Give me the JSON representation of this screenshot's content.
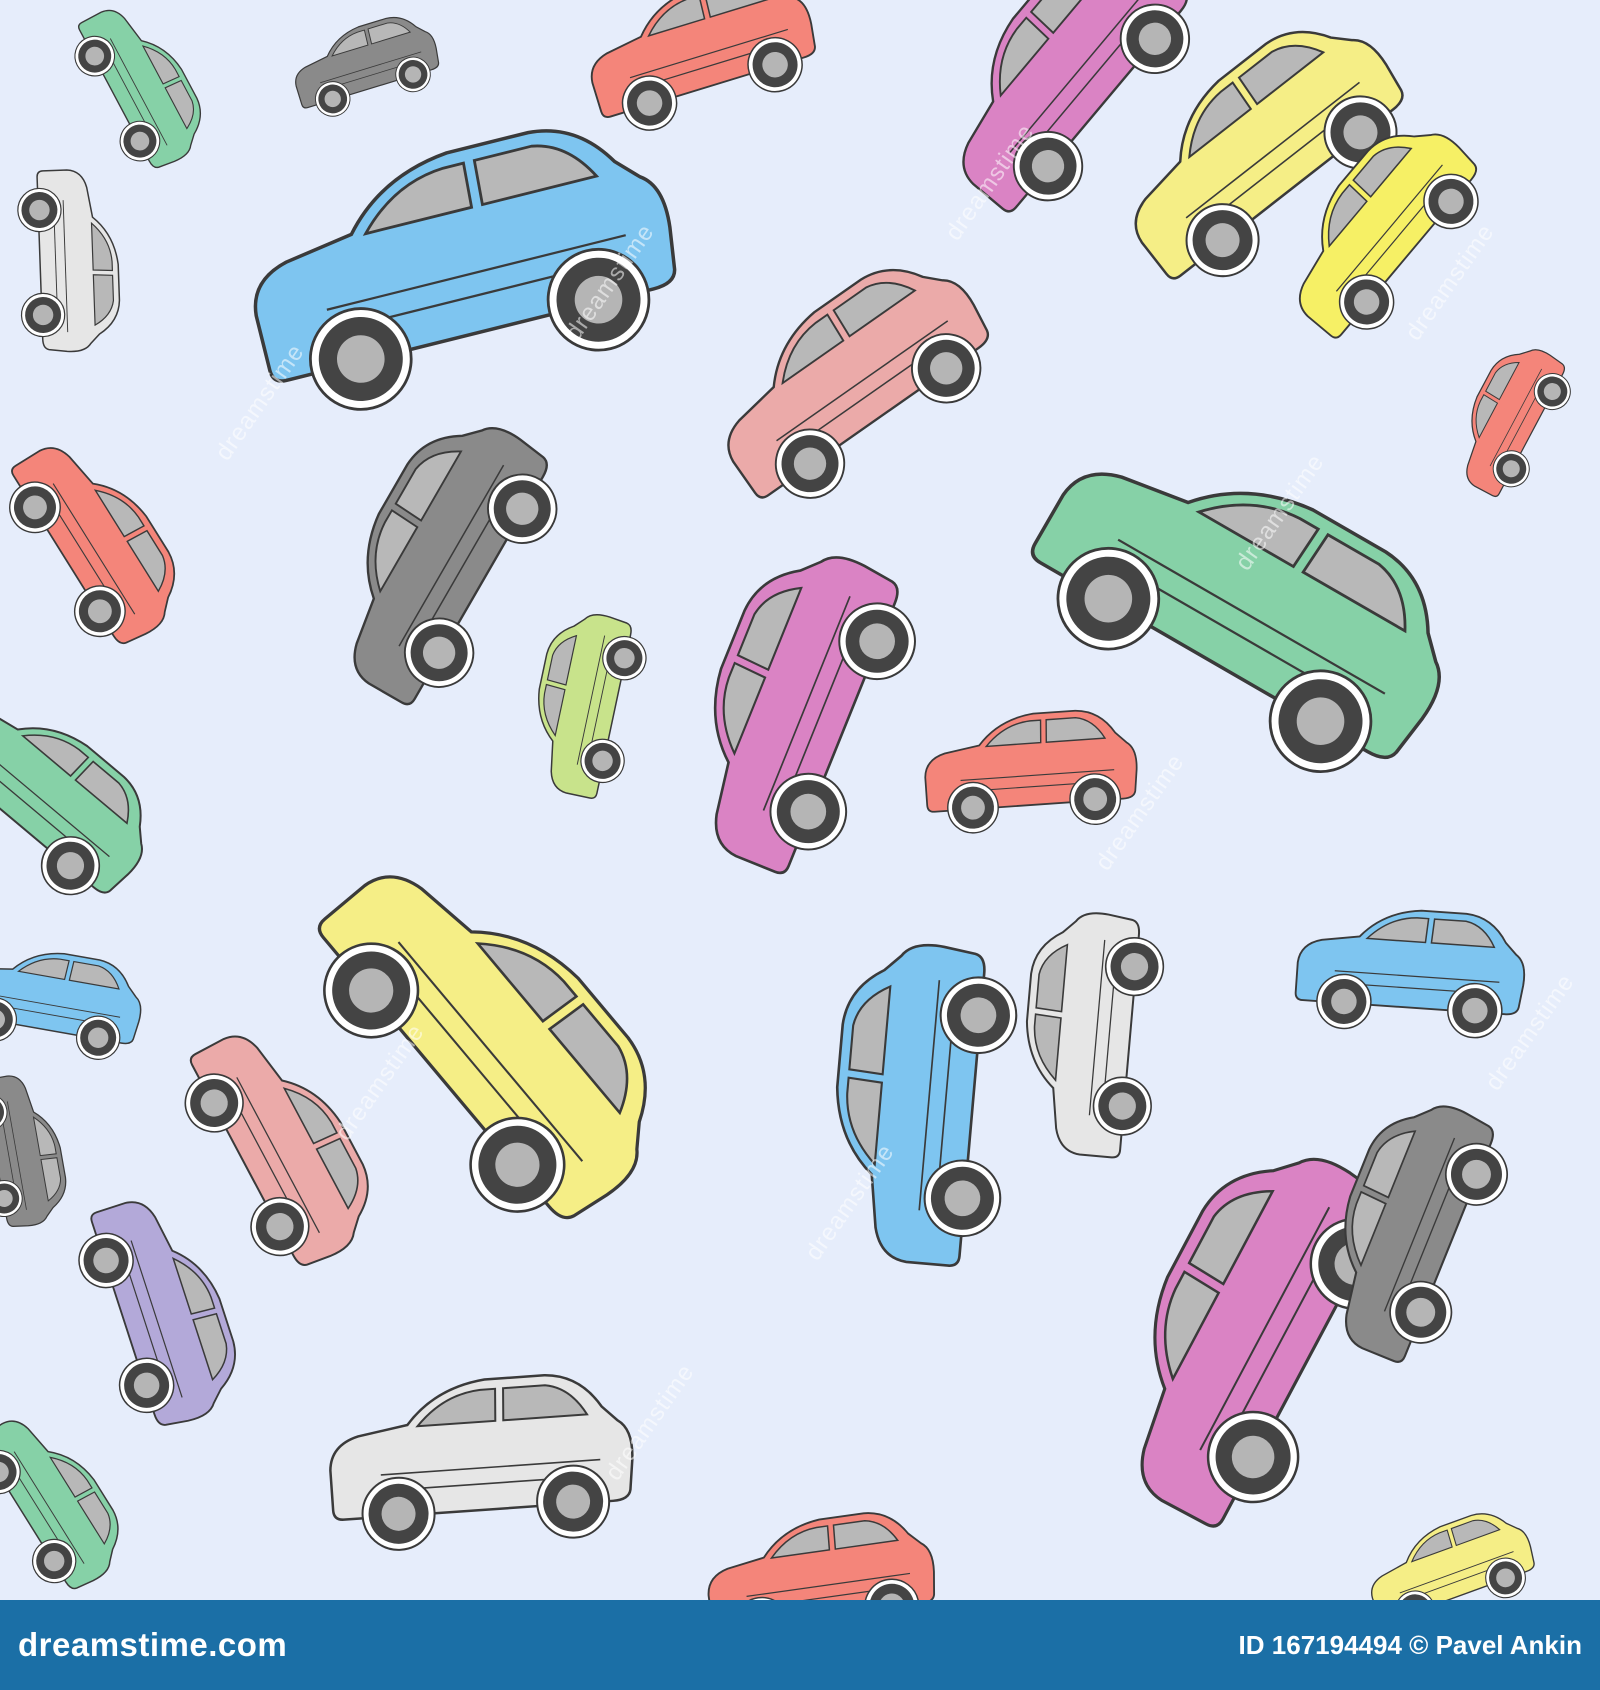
{
  "watermark": {
    "text": "dreamstime"
  },
  "footer": {
    "brand": "dreamstime.com",
    "image_id_label": "ID 167194494",
    "author": "Pavel Ankin",
    "copyright_symbol": "©"
  },
  "palette": {
    "background": "#e6edfb",
    "footer": "#1b6fa6",
    "outline": "#3a3a3a",
    "window": "#b8b8b8",
    "wheel_tire": "#444444",
    "wheel_hub": "#b5b5b5"
  },
  "cars": [
    {
      "color": "#86d1a7",
      "icon": "car-icon"
    },
    {
      "color": "#8a8a8a",
      "icon": "car-icon"
    },
    {
      "color": "#f4857a",
      "icon": "car-icon"
    },
    {
      "color": "#da83c4",
      "icon": "car-icon"
    },
    {
      "color": "#f5ee86",
      "icon": "car-icon"
    },
    {
      "color": "#f6f065",
      "icon": "car-icon"
    },
    {
      "color": "#7ec5f0",
      "icon": "car-icon"
    },
    {
      "color": "#ebaaa9",
      "icon": "car-icon"
    },
    {
      "color": "#e6e6e6",
      "icon": "car-icon"
    },
    {
      "color": "#f4857a",
      "icon": "car-icon"
    },
    {
      "color": "#8a8a8a",
      "icon": "car-icon"
    },
    {
      "color": "#c8e38b",
      "icon": "car-icon"
    },
    {
      "color": "#da83c4",
      "icon": "car-icon"
    },
    {
      "color": "#86d1a7",
      "icon": "car-icon"
    },
    {
      "color": "#f4857a",
      "icon": "car-icon"
    },
    {
      "color": "#f5ee86",
      "icon": "car-icon"
    },
    {
      "color": "#ebaaa9",
      "icon": "car-icon"
    },
    {
      "color": "#7ec5f0",
      "icon": "car-icon"
    },
    {
      "color": "#e6e6e6",
      "icon": "car-icon"
    },
    {
      "color": "#7ec5f0",
      "icon": "car-icon"
    },
    {
      "color": "#b3a9d9",
      "icon": "car-icon"
    },
    {
      "color": "#da83c4",
      "icon": "car-icon"
    },
    {
      "color": "#8a8a8a",
      "icon": "car-icon"
    },
    {
      "color": "#e6e6e6",
      "icon": "car-icon"
    },
    {
      "color": "#f4857a",
      "icon": "car-icon"
    },
    {
      "color": "#86d1a7",
      "icon": "car-icon"
    },
    {
      "color": "#f4857a",
      "icon": "car-icon"
    },
    {
      "color": "#f5ee86",
      "icon": "car-icon"
    },
    {
      "color": "#86d1a7",
      "icon": "car-icon"
    },
    {
      "color": "#7ec5f0",
      "icon": "car-icon"
    },
    {
      "color": "#8a8a8a",
      "icon": "car-icon"
    },
    {
      "color": "#f5ee86",
      "icon": "car-icon"
    }
  ]
}
